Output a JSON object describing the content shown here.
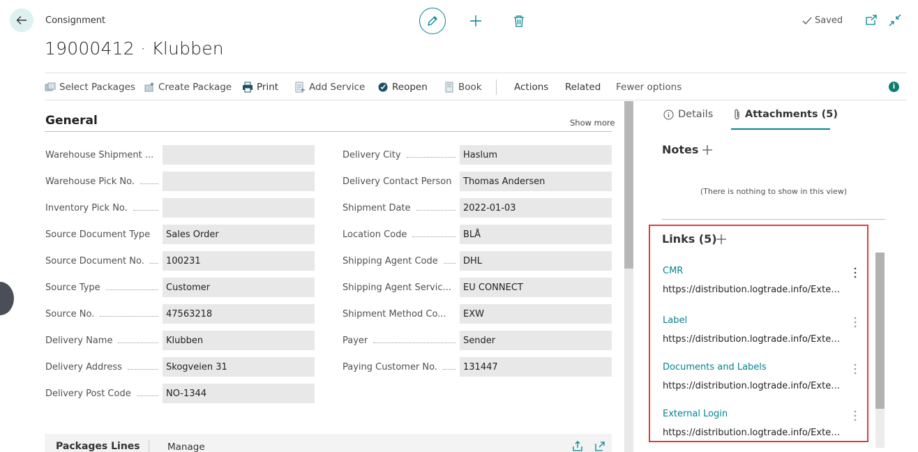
{
  "header": {
    "breadcrumb": "Consignment",
    "title": "19000412 · Klubben",
    "saved_label": "Saved"
  },
  "actions": [
    {
      "label": "Select Packages",
      "icon": "select-packages-icon"
    },
    {
      "label": "Create Package",
      "icon": "create-package-icon"
    },
    {
      "label": "Print",
      "icon": "printer-icon"
    },
    {
      "label": "Add Service",
      "icon": "add-service-icon"
    },
    {
      "label": "Reopen",
      "icon": "reopen-icon"
    },
    {
      "label": "Book",
      "icon": "book-icon"
    },
    {
      "label": "Actions"
    },
    {
      "label": "Related"
    },
    {
      "label": "Fewer options"
    }
  ],
  "general": {
    "title": "General",
    "show_more": "Show more",
    "left_fields": [
      {
        "label": "Warehouse Shipment ...",
        "value": ""
      },
      {
        "label": "Warehouse Pick No.",
        "value": ""
      },
      {
        "label": "Inventory Pick No.",
        "value": ""
      },
      {
        "label": "Source Document Type",
        "value": "Sales Order"
      },
      {
        "label": "Source Document No.",
        "value": "100231"
      },
      {
        "label": "Source Type",
        "value": "Customer"
      },
      {
        "label": "Source No.",
        "value": "47563218"
      },
      {
        "label": "Delivery Name",
        "value": "Klubben"
      },
      {
        "label": "Delivery Address",
        "value": "Skogveien 31"
      },
      {
        "label": "Delivery Post Code",
        "value": "NO-1344"
      }
    ],
    "right_fields": [
      {
        "label": "Delivery City",
        "value": "Haslum"
      },
      {
        "label": "Delivery Contact Person",
        "value": "Thomas Andersen"
      },
      {
        "label": "Shipment Date",
        "value": "2022-01-03"
      },
      {
        "label": "Location Code",
        "value": "BLÅ"
      },
      {
        "label": "Shipping Agent Code",
        "value": "DHL"
      },
      {
        "label": "Shipping Agent Servic...",
        "value": "EU CONNECT"
      },
      {
        "label": "Shipment Method Co...",
        "value": "EXW"
      },
      {
        "label": "Payer",
        "value": "Sender"
      },
      {
        "label": "Paying Customer No.",
        "value": "131447"
      }
    ]
  },
  "packages": {
    "title": "Packages Lines",
    "manage_label": "Manage"
  },
  "factbox": {
    "tabs": {
      "details": "Details",
      "attachments": "Attachments (5)"
    },
    "notes_title": "Notes",
    "notes_empty": "(There is nothing to show in this view)",
    "links_title": "Links (5)",
    "links": [
      {
        "name": "CMR",
        "url": "https://distribution.logtrade.info/ExternalLogin"
      },
      {
        "name": "Label",
        "url": "https://distribution.logtrade.info/ExternalLogin"
      },
      {
        "name": "Documents and Labels",
        "url": "https://distribution.logtrade.info/ExternalLogin"
      },
      {
        "name": "External Login",
        "url": "https://distribution.logtrade.info/ExternalLogin"
      }
    ]
  },
  "colors": {
    "accent": "#00838f",
    "highlight_box": "#e0393e"
  }
}
